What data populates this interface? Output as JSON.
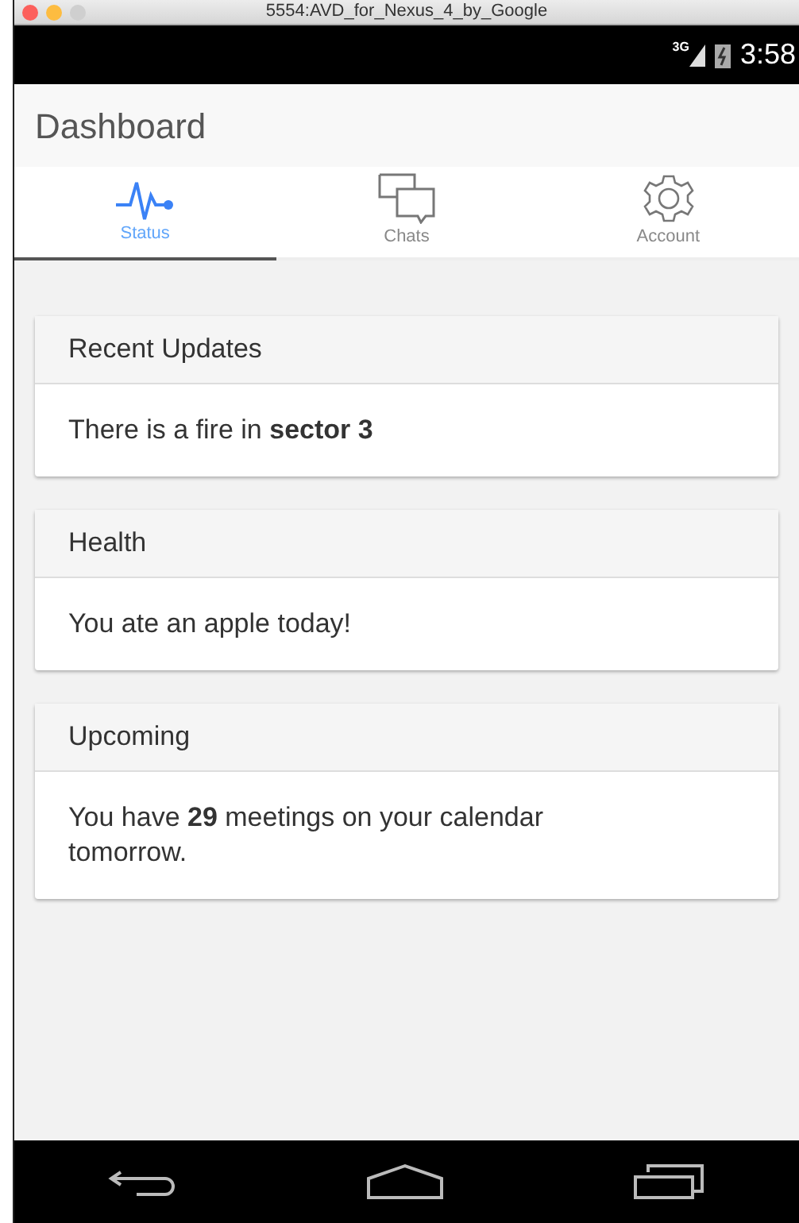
{
  "window": {
    "title": "5554:AVD_for_Nexus_4_by_Google"
  },
  "status_bar": {
    "network": "3G",
    "time": "3:58"
  },
  "app_bar": {
    "title": "Dashboard"
  },
  "tabs": [
    {
      "label": "Status",
      "kind": "pulse",
      "selected": true
    },
    {
      "label": "Chats",
      "kind": "chats",
      "selected": false
    },
    {
      "label": "Account",
      "kind": "gear",
      "selected": false
    }
  ],
  "cards": [
    {
      "title": "Recent Updates",
      "body": "There is a fire in **sector 3**"
    },
    {
      "title": "Health",
      "body": "You ate an apple today!"
    },
    {
      "title": "Upcoming",
      "body": "You have **29** meetings on your calendar tomorrow."
    }
  ]
}
